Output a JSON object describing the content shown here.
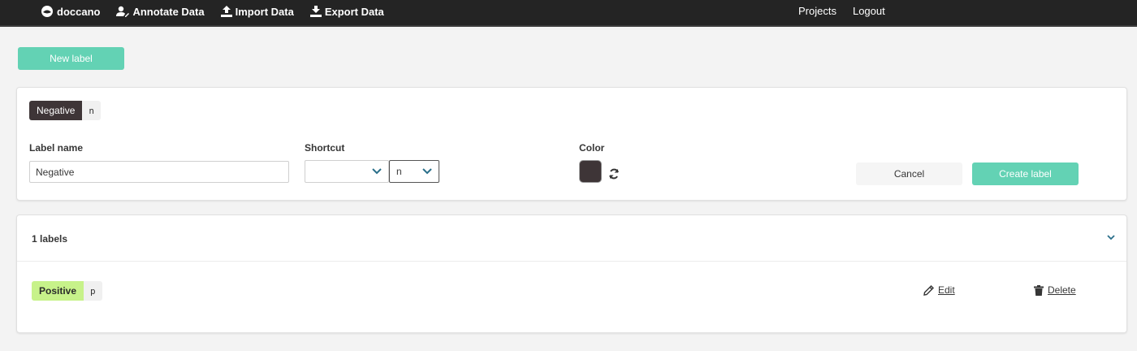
{
  "navbar": {
    "brand": "doccano",
    "annotate": "Annotate Data",
    "import": "Import Data",
    "export": "Export Data",
    "projects": "Projects",
    "logout": "Logout"
  },
  "new_label_button": "New label",
  "form": {
    "preview_tag": {
      "name": "Negative",
      "key": "n"
    },
    "label_name_label": "Label name",
    "label_name_value": "Negative",
    "shortcut_label": "Shortcut",
    "shortcut_modifier": "",
    "shortcut_key": "n",
    "color_label": "Color",
    "color_value": "#3e3537",
    "cancel_label": "Cancel",
    "create_label": "Create label"
  },
  "labels_list": {
    "title": "1 labels",
    "items": [
      {
        "name": "Positive",
        "key": "p",
        "color": "#c7f28a",
        "edit": "Edit",
        "delete": "Delete"
      }
    ]
  }
}
